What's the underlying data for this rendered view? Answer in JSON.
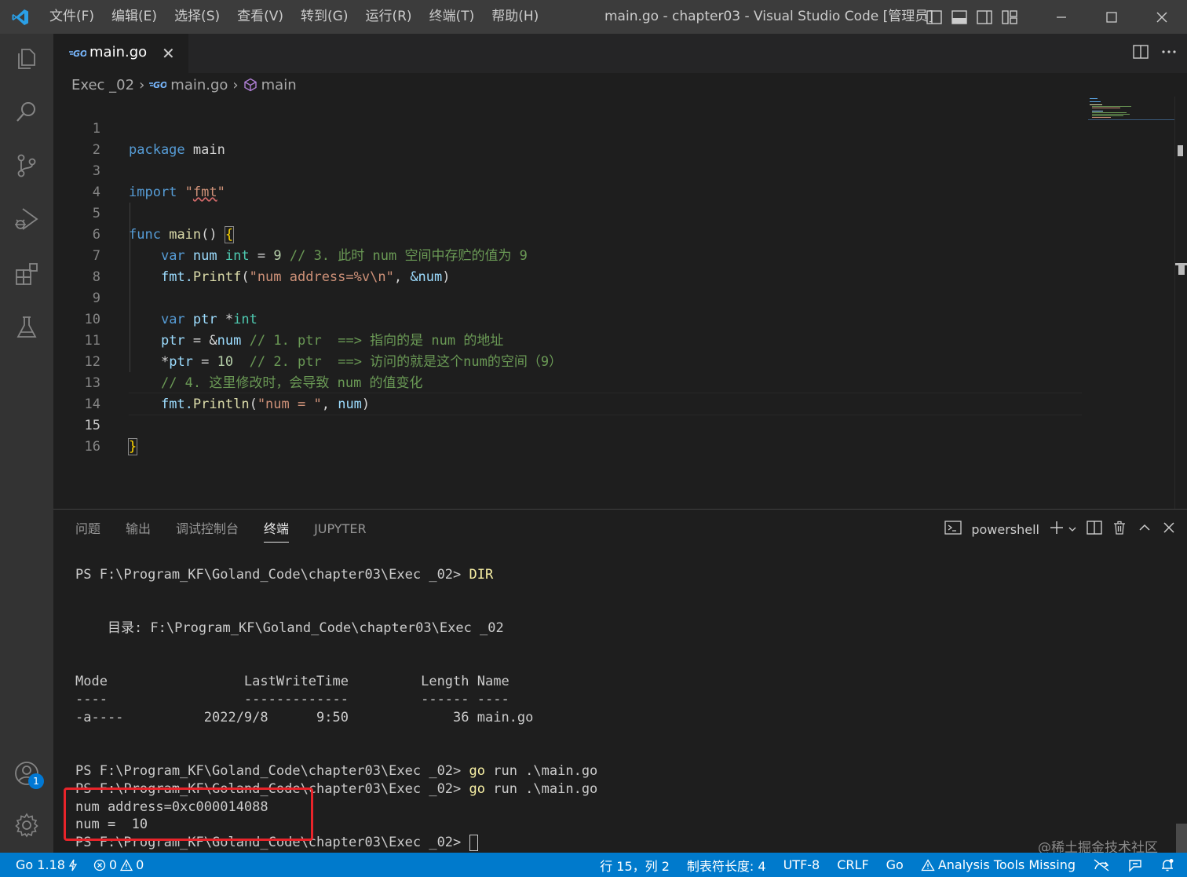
{
  "titlebar": {
    "menu": [
      "文件(F)",
      "编辑(E)",
      "选择(S)",
      "查看(V)",
      "转到(G)",
      "运行(R)",
      "终端(T)",
      "帮助(H)"
    ],
    "title": "main.go - chapter03 - Visual Studio Code [管理员]"
  },
  "activity": {
    "accounts_badge": "1"
  },
  "tab": {
    "label": "main.go",
    "close": "✕"
  },
  "breadcrumb": {
    "folder": "Exec _02",
    "file": "main.go",
    "symbol": "main"
  },
  "editor": {
    "line_numbers": [
      "1",
      "2",
      "3",
      "4",
      "5",
      "6",
      "7",
      "8",
      "9",
      "10",
      "11",
      "12",
      "13",
      "14",
      "15",
      "16"
    ],
    "active_line": "15",
    "code": {
      "l1_kw": "package",
      "l1_name": "main",
      "l3_kw": "import",
      "l3_q1": "\"",
      "l3_pkg": "fmt",
      "l3_q2": "\"",
      "l5_kw": "func",
      "l5_fn": "main",
      "l5_parens": "()",
      "l5_brace": "{",
      "l6_kw": "var",
      "l6_var": "num",
      "l6_type": "int",
      "l6_eq": "=",
      "l6_val": "9",
      "l6_cm": "// 3. 此时 num 空间中存贮的值为 9",
      "l7_pkg": "fmt.",
      "l7_fn": "Printf",
      "l7_open": "(",
      "l7_str": "\"num address=%v\\n\"",
      "l7_comma": ",",
      "l7_arg": "&num",
      "l7_close": ")",
      "l9_kw": "var",
      "l9_var": "ptr",
      "l9_star": "*",
      "l9_type": "int",
      "l10_var": "ptr",
      "l10_eq": "=",
      "l10_amp": "&",
      "l10_arg": "num",
      "l10_cm": "// 1. ptr  ==> 指向的是 num 的地址",
      "l11_star": "*",
      "l11_var": "ptr",
      "l11_eq": "=",
      "l11_val": "10",
      "l11_cm": "// 2. ptr  ==> 访问的就是这个num的空间（9）",
      "l12_cm": "// 4. 这里修改时，会导致 num 的值变化",
      "l13_pkg": "fmt.",
      "l13_fn": "Println",
      "l13_open": "(",
      "l13_str": "\"num = \"",
      "l13_comma": ",",
      "l13_arg": "num",
      "l13_close": ")",
      "l15_brace": "}"
    }
  },
  "panel": {
    "tabs": [
      "问题",
      "输出",
      "调试控制台",
      "终端",
      "JUPYTER"
    ],
    "active_tab": "终端",
    "shell": "powershell",
    "terminal": {
      "prompt1": "PS F:\\Program_KF\\Goland_Code\\chapter03\\Exec _02> ",
      "cmd1": "DIR",
      "dir_line": "    目录: F:\\Program_KF\\Goland_Code\\chapter03\\Exec _02",
      "header": "Mode                 LastWriteTime         Length Name",
      "underline": "----                 -------------         ------ ----",
      "row": "-a----          2022/9/8      9:50             36 main.go",
      "prompt2": "PS F:\\Program_KF\\Goland_Code\\chapter03\\Exec _02> ",
      "cmd2_go": "go",
      "cmd2_rest": " run .\\main.go",
      "prompt3": "PS F:\\Program_KF\\Goland_Code\\chapter03\\Exec _02> ",
      "cmd3_go": "go",
      "cmd3_rest": " run .\\main.go",
      "out1": "num address=0xc000014088",
      "out2": "num =  10",
      "prompt4": "PS F:\\Program_KF\\Goland_Code\\chapter03\\Exec _02> "
    },
    "watermark": "@稀土掘金技术社区"
  },
  "statusbar": {
    "go_version": "Go 1.18",
    "errors": "0",
    "warnings": "0",
    "position": "行 15，列 2",
    "indent": "制表符长度: 4",
    "encoding": "UTF-8",
    "eol": "CRLF",
    "language": "Go",
    "analysis": "Analysis Tools Missing"
  },
  "colors": {
    "accent": "#007acc",
    "highlight_box": "#e8242a"
  }
}
